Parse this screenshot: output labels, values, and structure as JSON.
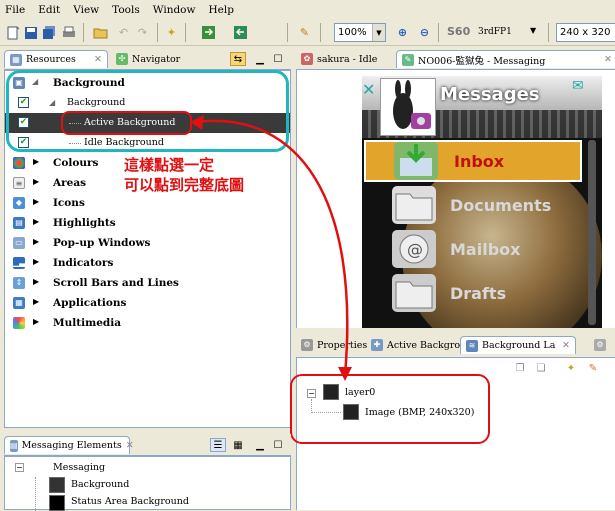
{
  "menu": [
    "File",
    "Edit",
    "View",
    "Tools",
    "Window",
    "Help"
  ],
  "toolbar": {
    "zoom": "100%",
    "device_logo": "S60",
    "device_edition": "3rdFP1",
    "resolution": "240 x 320"
  },
  "left_tabs": {
    "resources": "Resources",
    "navigator": "Navigator"
  },
  "tree": {
    "background_group": "Background",
    "background_item": "Background",
    "active_bg": "Active Background",
    "idle_bg": "Idle Background",
    "groups": [
      "Colours",
      "Areas",
      "Icons",
      "Highlights",
      "Pop-up Windows",
      "Indicators",
      "Scroll Bars and Lines",
      "Applications",
      "Multimedia"
    ]
  },
  "annotation": {
    "line1": "這樣點選一定",
    "line2": "可以點到完整底圖"
  },
  "editor_tabs": {
    "tab1": "sakura - Idle",
    "tab2": "NO006-監獄兔 - Messaging"
  },
  "phone": {
    "title": "Messages",
    "items": [
      "Inbox",
      "Documents",
      "Mailbox",
      "Drafts"
    ]
  },
  "bottom_tabs": {
    "properties": "Properties",
    "active_bg": "Active Backgro",
    "layers": "Background La"
  },
  "layers": {
    "layer": "layer0",
    "image": "Image (BMP, 240x320)"
  },
  "messaging_panel": {
    "title": "Messaging Elements",
    "root": "Messaging",
    "children": [
      "Background",
      "Status Area Background"
    ]
  },
  "colors": {
    "annotation_red": "#e01010",
    "teal_frame": "#20b6c0",
    "selected_row": "#3a3a3a",
    "highlight_orange": "#e2a42a"
  }
}
